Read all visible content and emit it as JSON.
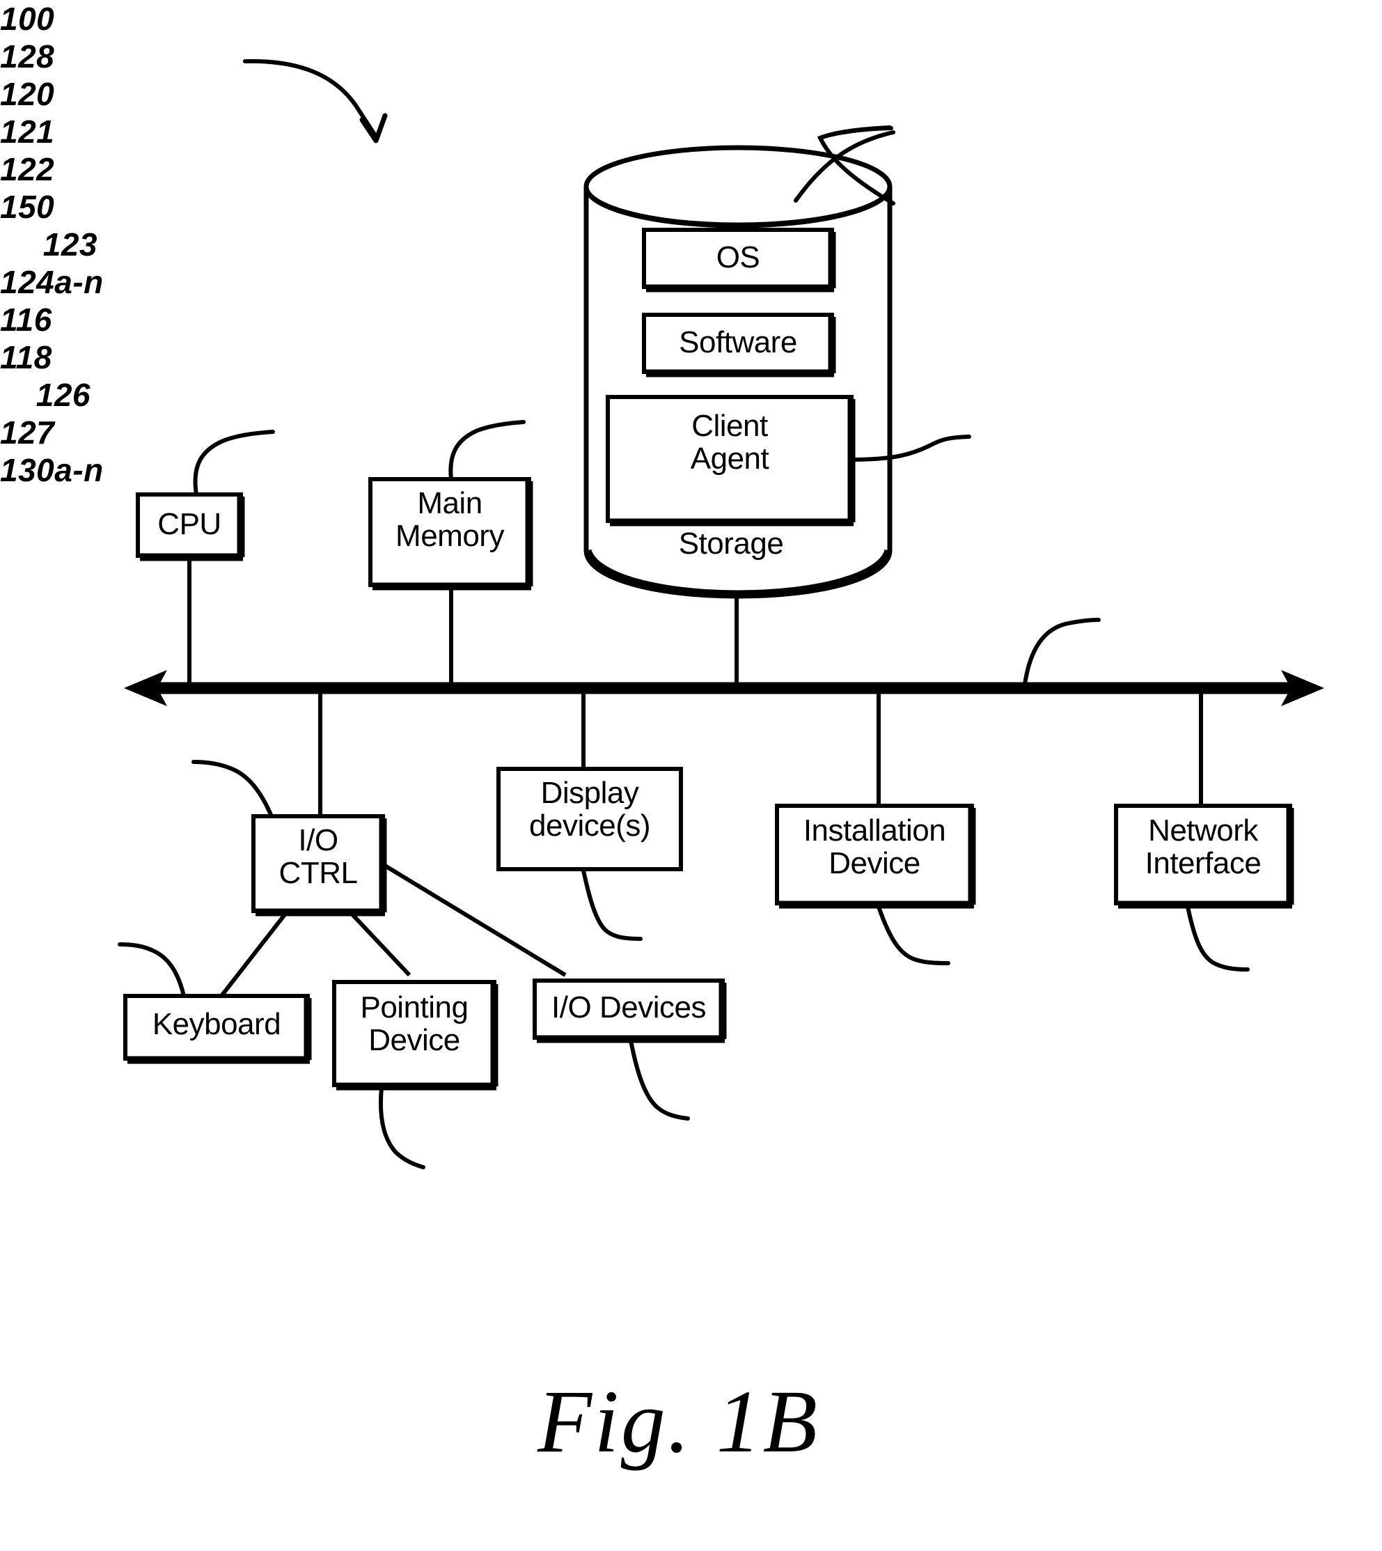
{
  "figure": {
    "caption": "Fig. 1B",
    "system_ref": "100"
  },
  "blocks": {
    "cpu": {
      "label": "CPU",
      "ref": "121"
    },
    "main_memory": {
      "label": "Main\nMemory",
      "ref": "122"
    },
    "storage": {
      "label": "Storage",
      "ref": "128"
    },
    "os": {
      "label": "OS"
    },
    "software": {
      "label": "Software"
    },
    "client_agent": {
      "label": "Client\nAgent",
      "ref": "120"
    },
    "bus": {
      "ref": "150"
    },
    "io_ctrl": {
      "label": "I/O\nCTRL",
      "ref": "123"
    },
    "display_devices": {
      "label": "Display\ndevice(s)",
      "ref": "124a-n"
    },
    "installation_device": {
      "label": "Installation\nDevice",
      "ref": "116"
    },
    "network_interface": {
      "label": "Network\nInterface",
      "ref": "118"
    },
    "keyboard": {
      "label": "Keyboard",
      "ref": "126"
    },
    "pointing_device": {
      "label": "Pointing\nDevice",
      "ref": "127"
    },
    "io_devices": {
      "label": "I/O Devices",
      "ref": "130a-n"
    }
  },
  "colors": {
    "ink": "#000000",
    "paper": "#ffffff"
  }
}
